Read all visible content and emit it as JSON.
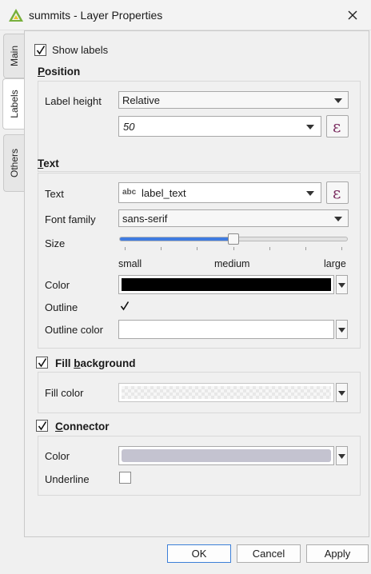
{
  "window": {
    "title": "summits - Layer Properties"
  },
  "tabs": [
    {
      "label": "Main"
    },
    {
      "label": "Labels",
      "active": true
    },
    {
      "label": "Others"
    }
  ],
  "show_labels": {
    "label": "Show labels",
    "checked": true
  },
  "position": {
    "title_first": "P",
    "title_rest": "osition",
    "label_height_label": "Label height",
    "label_height_value": "Relative",
    "height_value": "50"
  },
  "text": {
    "title_first": "T",
    "title_rest": "ext",
    "text_label": "Text",
    "text_prefix": "abc",
    "text_value": "label_text",
    "font_family_label": "Font family",
    "font_family_value": "sans-serif",
    "size_label": "Size",
    "size_fraction": 0.5,
    "size_small": "small",
    "size_medium": "medium",
    "size_large": "large",
    "color_label": "Color",
    "color_value": "#000000",
    "outline_label": "Outline",
    "outline_checked": true,
    "outline_color_label": "Outline color",
    "outline_color_value": "#ffffff"
  },
  "fill_background": {
    "label_before": "Fill ",
    "label_underlined": "b",
    "label_after": "ackground",
    "checked": true,
    "fill_color_label": "Fill color"
  },
  "connector": {
    "title_first": "C",
    "title_rest": "onnector",
    "checked": true,
    "color_label": "Color",
    "color_value": "#c4c3d0",
    "underline_label": "Underline",
    "underline_checked": false
  },
  "buttons": {
    "ok": "OK",
    "cancel": "Cancel",
    "apply": "Apply"
  },
  "icons": {
    "app": "qgis-triangle-icon",
    "close": "close-icon",
    "expression": "expression-epsilon-icon",
    "dropdown": "chevron-down-icon"
  },
  "expression_glyph": "ε"
}
